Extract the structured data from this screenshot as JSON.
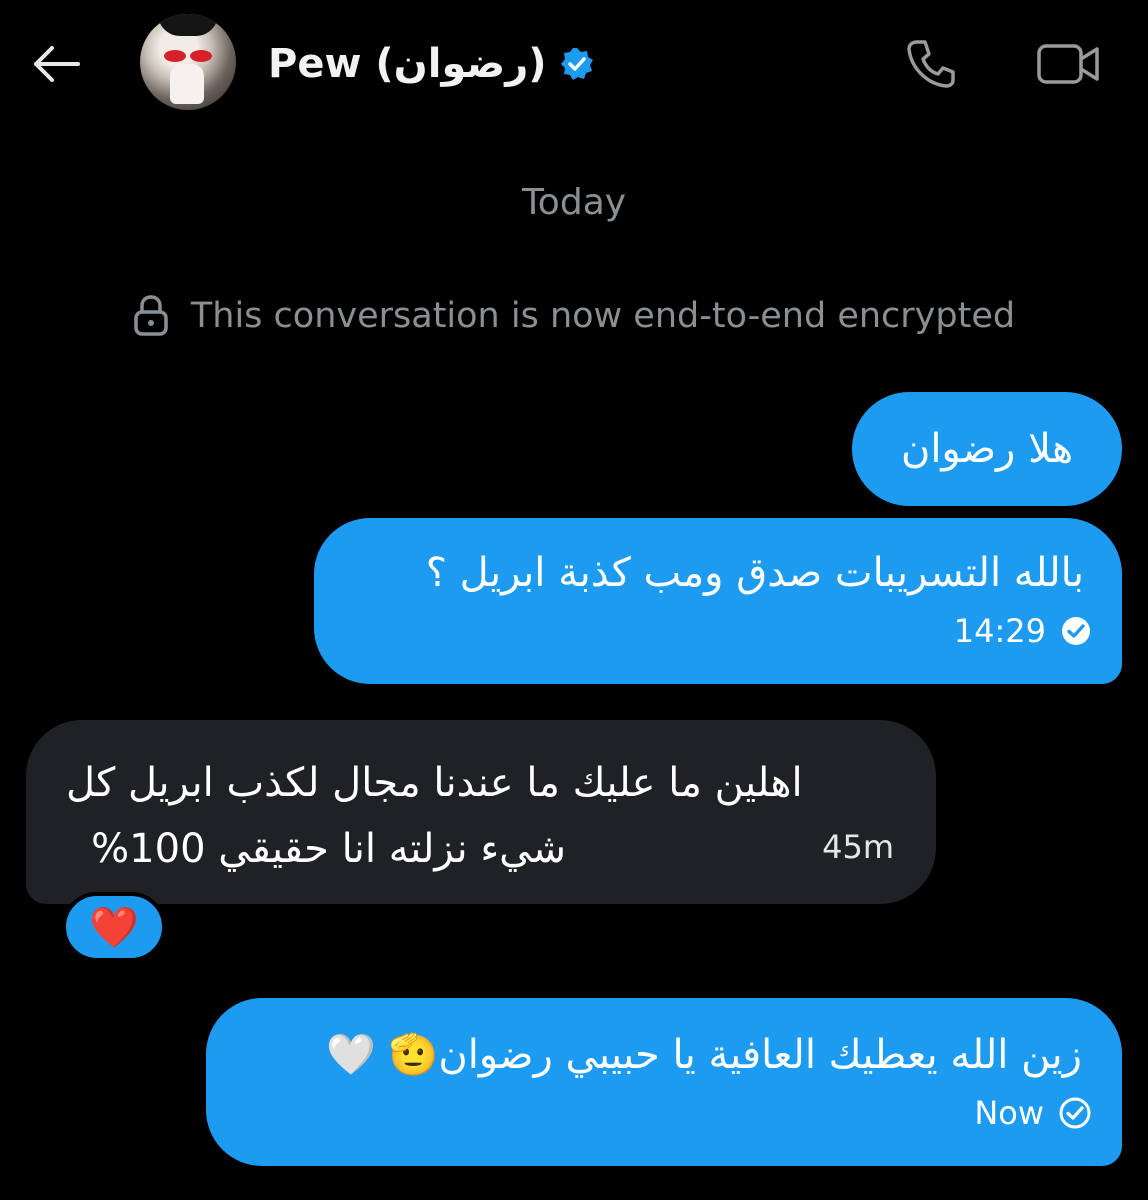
{
  "header": {
    "title": "Pew (رضوان)",
    "icons": [
      "arrow-left-icon",
      "verified-badge-icon",
      "phone-icon",
      "video-camera-icon"
    ]
  },
  "conversation": {
    "date_label": "Today",
    "encryption_notice": "This conversation is now end-to-end encrypted"
  },
  "messages": [
    {
      "direction": "outgoing",
      "text": "هلا رضوان"
    },
    {
      "direction": "outgoing",
      "text": "بالله التسريبات صدق ومب كذبة ابريل ؟",
      "time": "14:29",
      "status": "sent"
    },
    {
      "direction": "incoming",
      "text_line1": "اهلين ما عليك ما عندنا مجال لكذب ابريل كل",
      "text_line2": "شيء نزلته انا حقيقي 100%",
      "time": "45m",
      "reaction": "❤️"
    },
    {
      "direction": "outgoing",
      "text": "زين الله يعطيك العافية يا حبيبي رضوان🫡 🤍",
      "time": "Now",
      "status": "sent"
    }
  ],
  "colors": {
    "outgoing": "#1d9bf0",
    "incoming": "#1f2124",
    "muted": "#8a8f93",
    "background": "#000000"
  }
}
